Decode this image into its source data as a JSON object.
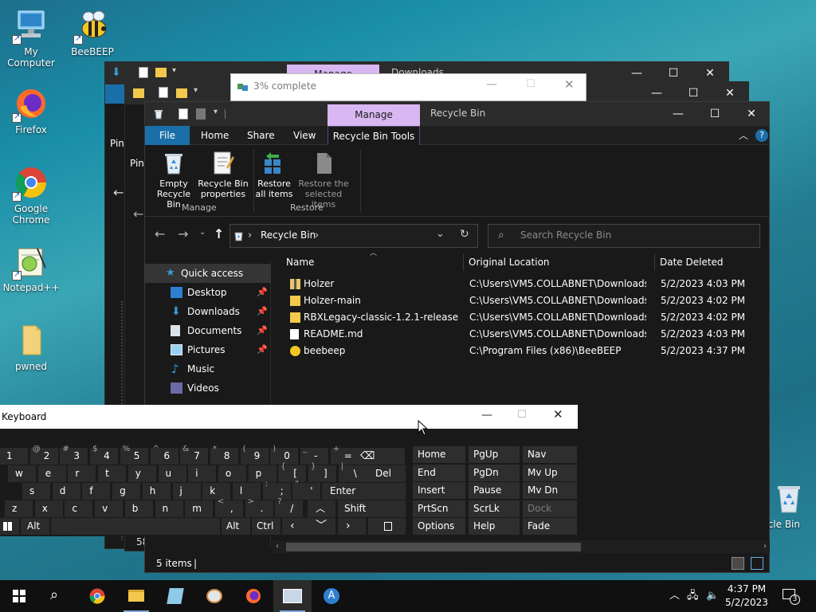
{
  "desktop": {
    "icons": [
      {
        "label": "My Computer"
      },
      {
        "label": "BeeBEEP"
      },
      {
        "label": "Firefox"
      },
      {
        "label": "Google Chrome"
      },
      {
        "label": "Notepad++"
      },
      {
        "label": "pwned"
      },
      {
        "label": "cle Bin"
      }
    ]
  },
  "back_windows": {
    "downloads_manage_tab": "Manage",
    "downloads_title": "Downloads",
    "side_text_1": "Pin",
    "side_text_2": "Pin",
    "side_text_3": "58"
  },
  "progress": {
    "title": "3% complete",
    "percent": 3
  },
  "explorer": {
    "manage_tab": "Manage",
    "title": "Recycle Bin",
    "tabs": {
      "file": "File",
      "home": "Home",
      "share": "Share",
      "view": "View",
      "tools": "Recycle Bin Tools"
    },
    "ribbon": {
      "empty_line1": "Empty",
      "empty_line2": "Recycle Bin",
      "props_line1": "Recycle Bin",
      "props_line2": "properties",
      "restore_all_line1": "Restore",
      "restore_all_line2": "all items",
      "restore_sel_line1": "Restore the",
      "restore_sel_line2": "selected items",
      "group_manage": "Manage",
      "group_restore": "Restore"
    },
    "address": {
      "crumb": "Recycle Bin",
      "sep": "›"
    },
    "search": {
      "placeholder": "Search Recycle Bin"
    },
    "nav": {
      "quick_access": "Quick access",
      "items": [
        {
          "label": "Desktop",
          "pinned": true
        },
        {
          "label": "Downloads",
          "pinned": true
        },
        {
          "label": "Documents",
          "pinned": true
        },
        {
          "label": "Pictures",
          "pinned": true
        },
        {
          "label": "Music",
          "pinned": false
        },
        {
          "label": "Videos",
          "pinned": false
        }
      ]
    },
    "columns": {
      "name": "Name",
      "location": "Original Location",
      "date": "Date Deleted"
    },
    "files": [
      {
        "name": "Holzer",
        "location": "C:\\Users\\VM5.COLLABNET\\Downloads\\...",
        "date": "5/2/2023 4:03 PM",
        "type": "zip-folder"
      },
      {
        "name": "Holzer-main",
        "location": "C:\\Users\\VM5.COLLABNET\\Downloads",
        "date": "5/2/2023 4:02 PM",
        "type": "folder"
      },
      {
        "name": "RBXLegacy-classic-1.2.1-release",
        "location": "C:\\Users\\VM5.COLLABNET\\Downloads",
        "date": "5/2/2023 4:02 PM",
        "type": "folder"
      },
      {
        "name": "README.md",
        "location": "C:\\Users\\VM5.COLLABNET\\Downloads\\...",
        "date": "5/2/2023 4:03 PM",
        "type": "file"
      },
      {
        "name": "beebeep",
        "location": "C:\\Program Files (x86)\\BeeBEEP",
        "date": "5/2/2023 4:37 PM",
        "type": "app"
      }
    ],
    "status": {
      "items": "5 items",
      "cursor": "|"
    }
  },
  "keyboard": {
    "title": "Keyboard",
    "row1": [
      {
        "main": "1",
        "sub": ""
      },
      {
        "main": "2",
        "sub": "@"
      },
      {
        "main": "3",
        "sub": "#"
      },
      {
        "main": "4",
        "sub": "$"
      },
      {
        "main": "5",
        "sub": "%"
      },
      {
        "main": "6",
        "sub": "^"
      },
      {
        "main": "7",
        "sub": "&"
      },
      {
        "main": "8",
        "sub": "*"
      },
      {
        "main": "9",
        "sub": "("
      },
      {
        "main": "0",
        "sub": ")"
      },
      {
        "main": "-",
        "sub": "_"
      },
      {
        "main": "=",
        "sub": "+"
      }
    ],
    "row2": [
      "w",
      "e",
      "r",
      "t",
      "y",
      "u",
      "i",
      "o",
      "p"
    ],
    "row2_extra": [
      {
        "main": "[",
        "sub": "{"
      },
      {
        "main": "]",
        "sub": "}"
      },
      {
        "main": "\\",
        "sub": "|"
      }
    ],
    "row3": [
      "s",
      "d",
      "f",
      "g",
      "h",
      "j",
      "k",
      "l"
    ],
    "row3_extra": [
      {
        "main": ";",
        "sub": ":"
      },
      {
        "main": "'",
        "sub": "\""
      }
    ],
    "row4": [
      "z",
      "x",
      "c",
      "v",
      "b",
      "n",
      "m"
    ],
    "row4_extra": [
      {
        "main": ",",
        "sub": "<"
      },
      {
        "main": ".",
        "sub": ">"
      },
      {
        "main": "/",
        "sub": "?"
      }
    ],
    "del": "Del",
    "enter": "Enter",
    "shift": "Shift",
    "alt_left": "Alt",
    "alt_right": "Alt",
    "ctrl": "Ctrl",
    "fn": [
      [
        "Home",
        "PgUp",
        "Nav"
      ],
      [
        "End",
        "PgDn",
        "Mv Up"
      ],
      [
        "Insert",
        "Pause",
        "Mv Dn"
      ],
      [
        "PrtScn",
        "ScrLk",
        "Dock"
      ],
      [
        "Options",
        "Help",
        "Fade"
      ]
    ]
  },
  "taskbar": {
    "time": "4:37 PM",
    "date": "5/2/2023",
    "notifications": "3"
  }
}
